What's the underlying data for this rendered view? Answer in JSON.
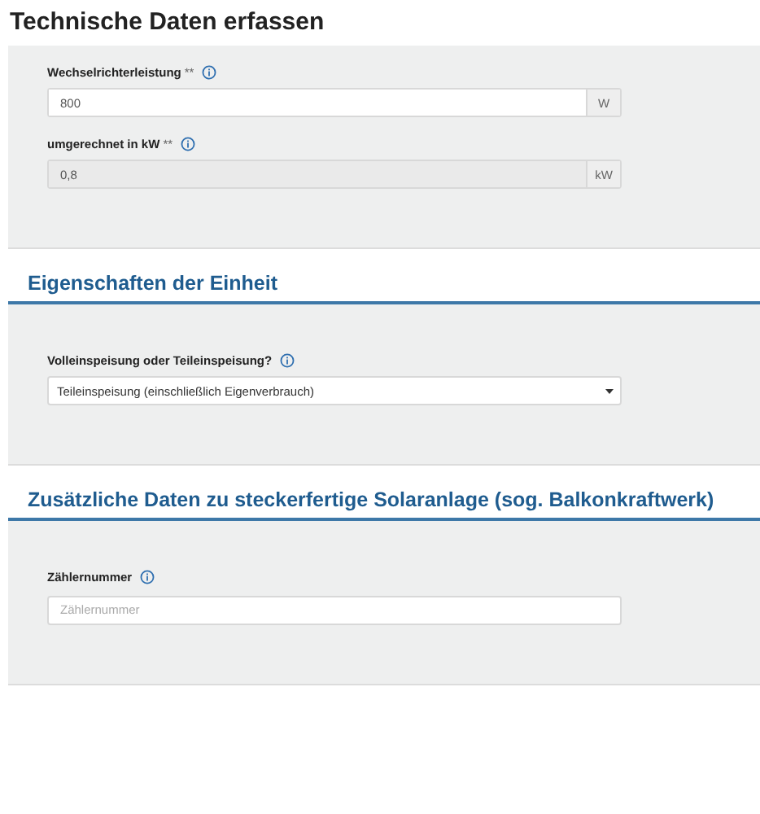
{
  "title": "Technische Daten erfassen",
  "sections": [
    {
      "fields": [
        {
          "kind": "unit",
          "label": "Wechselrichterleistung",
          "required_mark": "**",
          "value": "800",
          "unit": "W",
          "disabled": false
        },
        {
          "kind": "unit",
          "label": "umgerechnet in kW",
          "required_mark": "**",
          "value": "0,8",
          "unit": "kW",
          "disabled": true
        }
      ]
    },
    {
      "heading": "Eigenschaften der Einheit",
      "fields": [
        {
          "kind": "select",
          "label": "Volleinspeisung oder Teileinspeisung?",
          "value": "Teileinspeisung (einschließlich Eigenverbrauch)"
        }
      ]
    },
    {
      "heading": "Zusätzliche Daten zu steckerfertige Solaranlage (sog. Balkonkraftwerk)",
      "fields": [
        {
          "kind": "text",
          "label": "Zählernummer",
          "placeholder": "Zählernummer"
        }
      ]
    }
  ]
}
